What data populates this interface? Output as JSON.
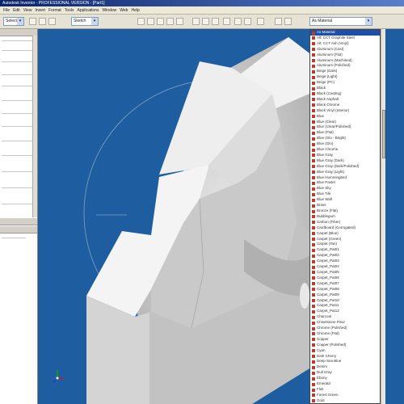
{
  "app": {
    "title": "Autodesk Inventor - PROFESSIONAL VERSION - [Part1]"
  },
  "menu": [
    "File",
    "Edit",
    "View",
    "Insert",
    "Format",
    "Tools",
    "Applications",
    "Window",
    "Web",
    "Help"
  ],
  "toolbar": {
    "select_label": "Select",
    "return_label": "Return",
    "sketch_label": "Sketch",
    "material_combo_value": "As Material"
  },
  "materials": {
    "selected_index": 0,
    "items": [
      "As Material",
      "Alt: CCT Graphite Steel",
      "Alt: CCT Ash (Vinyl)",
      "Aluminum (Cast)",
      "Aluminum (Flat)",
      "Aluminum (Machined)",
      "Aluminum (Polished)",
      "Beige (Dark)",
      "Beige (Light)",
      "Beige (PC)",
      "Black",
      "Black (Casting)",
      "Black Asphalt",
      "Black Chrome",
      "Black Vinyl (Interior)",
      "Blue",
      "Blue (Clear)",
      "Blue (Clear/Polished)",
      "Blue (Flat)",
      "Blue (Glo - Bright)",
      "Blue (Glo)",
      "Blue Chrome",
      "Blue Gray",
      "Blue Gray (Dark)",
      "Blue Gray (Dark/Polished)",
      "Blue Gray (Light)",
      "Blue Hummingbird",
      "Blue Pastel",
      "Blue Sky",
      "Blue Tile",
      "Blue Wall",
      "Brass",
      "Bronze (Flat)",
      "Bubblegum",
      "Carbon (Fiber)",
      "Cardboard (Corrugated)",
      "Carpet (Blue)",
      "Carpet (Green)",
      "Carpet (Tan)",
      "Carpet_Pat01",
      "Carpet_Pat02",
      "Carpet_Pat03",
      "Carpet_Pat04",
      "Carpet_Pat05",
      "Carpet_Pat06",
      "Carpet_Pat07",
      "Carpet_Pat08",
      "Carpet_Pat09",
      "Carpet_Pat10",
      "Carpet_Pat11",
      "Carpet_Pat12",
      "Charcoal",
      "Chiselstone Fleur",
      "Chrome (Polished)",
      "Chrome (Flat)",
      "Copper",
      "Copper (Polished)",
      "Cyan",
      "Dark Cherry",
      "Deep Sea Blue",
      "Denim",
      "Dull Gray",
      "Ebony",
      "Emerald",
      "Flint",
      "Forest Green",
      "Gold"
    ]
  },
  "viewport": {
    "background_color": "#1e5ea0",
    "axis_indicator": "xyz-triad-icon"
  }
}
